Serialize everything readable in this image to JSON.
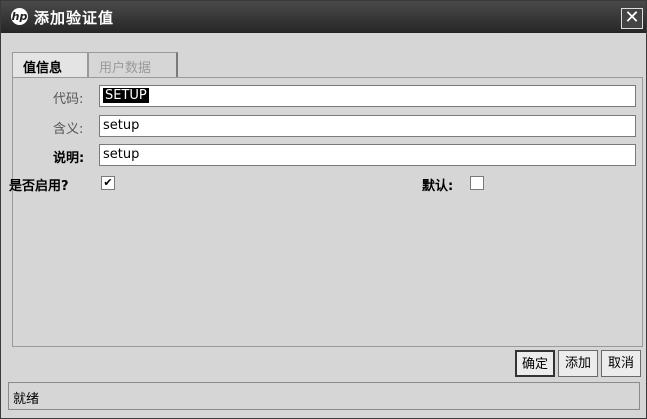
{
  "window": {
    "title": "添加验证值",
    "logo": "hp",
    "close_glyph": "✕"
  },
  "tabs": [
    {
      "label": "值信息",
      "active": true
    },
    {
      "label": "用户数据",
      "active": false
    }
  ],
  "form": {
    "code": {
      "label": "代码:",
      "value": "SETUP"
    },
    "meaning": {
      "label": "含义:",
      "value": "setup"
    },
    "description": {
      "label": "说明:",
      "value": "setup"
    },
    "enabled": {
      "label": "是否启用?",
      "checked": true,
      "check_glyph": "✔"
    },
    "default": {
      "label": "默认:",
      "checked": false
    }
  },
  "buttons": {
    "ok": "确定",
    "add": "添加",
    "cancel": "取消"
  },
  "status": {
    "text": "就绪"
  }
}
